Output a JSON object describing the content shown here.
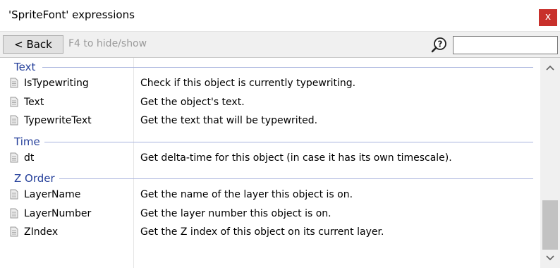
{
  "window": {
    "title": "'SpriteFont' expressions",
    "close_label": "x"
  },
  "toolbar": {
    "back_label": "< Back",
    "hint": "F4 to hide/show",
    "search_value": "",
    "search_placeholder": ""
  },
  "groups": [
    {
      "name": "Text",
      "items": [
        {
          "name": "IsTypewriting",
          "description": "Check if this object is currently typewriting."
        },
        {
          "name": "Text",
          "description": "Get the object's text."
        },
        {
          "name": "TypewriteText",
          "description": "Get the text that will be typewrited."
        }
      ]
    },
    {
      "name": "Time",
      "items": [
        {
          "name": "dt",
          "description": "Get delta-time for this object (in case it has its own timescale)."
        }
      ]
    },
    {
      "name": "Z Order",
      "items": [
        {
          "name": "LayerName",
          "description": "Get the name of the layer this object is on."
        },
        {
          "name": "LayerNumber",
          "description": "Get the layer number this object is on."
        },
        {
          "name": "ZIndex",
          "description": "Get the Z index of this object on its current layer."
        }
      ]
    }
  ],
  "colors": {
    "group_text": "#243f9a",
    "close_button": "#c8302b"
  },
  "icons": {
    "close": "close-icon",
    "search": "search-help-icon",
    "expression": "expression-icon",
    "scroll_up": "chevron-up-icon",
    "scroll_down": "chevron-down-icon"
  }
}
